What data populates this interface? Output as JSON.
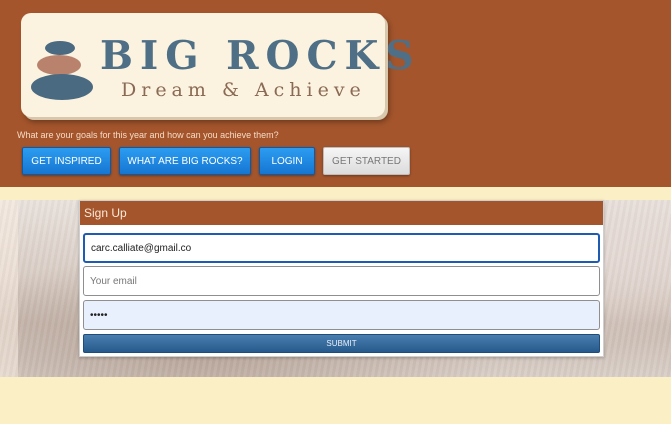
{
  "logo": {
    "title": "BIG ROCKS",
    "subtitle": "Dream & Achieve"
  },
  "tagline": "What are your goals for this year and how can you achieve them?",
  "nav": {
    "inspired": "GET INSPIRED",
    "what": "WHAT ARE BIG ROCKS?",
    "login": "LOGIN",
    "started": "GET STARTED"
  },
  "signup": {
    "heading": "Sign Up",
    "username_value": "carc.calliate@gmail.co",
    "email_placeholder": "Your email",
    "password_value": "•••••",
    "submit": "SUBMIT"
  },
  "colors": {
    "header_brown": "#a4552c",
    "page_cream": "#fbefc6",
    "button_blue": "#1676d2",
    "logo_blue": "#4e6f86"
  }
}
